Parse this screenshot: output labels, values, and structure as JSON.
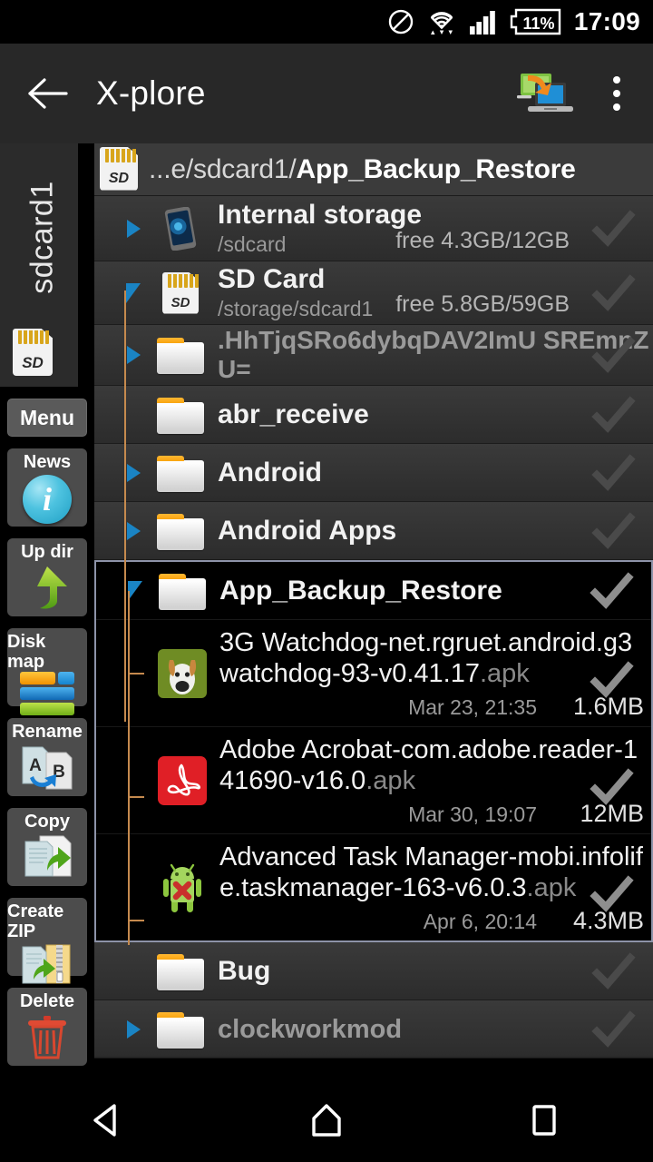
{
  "statusbar": {
    "icons": [
      "do-not-disturb-icon",
      "wifi-icon",
      "cellular-signal-icon",
      "battery-icon"
    ],
    "battery_percent": "11%",
    "clock": "17:09"
  },
  "appbar": {
    "back_label": "back-arrow",
    "title": "X-plore",
    "pc_transfer_icon": "wifi-pc-transfer-icon",
    "overflow_label": "more-options"
  },
  "sidebar": {
    "tab_label": "sdcard1",
    "tab_icon": "sd-card-icon",
    "menu_label": "Menu",
    "buttons": [
      {
        "label": "News",
        "icon": "info-circle-icon"
      },
      {
        "label": "Up dir",
        "icon": "up-arrow-icon"
      },
      {
        "label": "Disk map",
        "icon": "disk-map-icon"
      },
      {
        "label": "Rename",
        "icon": "rename-ab-icon"
      },
      {
        "label": "Copy",
        "icon": "copy-icon"
      },
      {
        "label": "Create ZIP",
        "icon": "zip-icon"
      },
      {
        "label": "Delete",
        "icon": "trash-icon"
      }
    ]
  },
  "breadcrumb": {
    "icon": "sd-card-icon",
    "prefix": "...e/sdcard1/",
    "current": "App_Backup_Restore"
  },
  "filelist": {
    "rows": [
      {
        "kind": "storage",
        "name": "Internal storage",
        "path": "/sdcard",
        "free": "free 4.3GB/12GB",
        "icon": "phone-icon",
        "expander": "collapsed",
        "checked": false,
        "highlight": false
      },
      {
        "kind": "storage",
        "name": "SD Card",
        "path": "/storage/sdcard1",
        "free": "free 5.8GB/59GB",
        "icon": "sd-card-icon",
        "expander": "expanded",
        "checked": false,
        "highlight": false
      },
      {
        "kind": "folder",
        "name": ".HhTjqSRo6dybqDAV2ImU SREmnZU=",
        "icon": "folder-icon",
        "expander": "collapsed",
        "dimmed": true,
        "checked": false,
        "highlight": false
      },
      {
        "kind": "folder",
        "name": "abr_receive",
        "icon": "folder-icon",
        "expander": "none",
        "checked": false,
        "highlight": false
      },
      {
        "kind": "folder",
        "name": "Android",
        "icon": "folder-icon",
        "expander": "collapsed",
        "checked": false,
        "highlight": false
      },
      {
        "kind": "folder",
        "name": "Android Apps",
        "icon": "folder-icon",
        "expander": "collapsed",
        "checked": false,
        "highlight": false
      }
    ],
    "highlighted_group": {
      "folder": {
        "kind": "folder",
        "name": "App_Backup_Restore",
        "icon": "folder-icon",
        "expander": "expanded",
        "checked": false
      },
      "files": [
        {
          "kind": "file",
          "name": "3G Watchdog-net.rgruet.android.g3watchdog-93-v0.41.17",
          "ext": ".apk",
          "icon": "3g-watchdog-app-icon",
          "date": "Mar 23, 21:35",
          "size": "1.6MB",
          "checked": false
        },
        {
          "kind": "file",
          "name": "Adobe Acrobat-com.adobe.reader-141690-v16.0",
          "ext": ".apk",
          "icon": "adobe-acrobat-app-icon",
          "date": "Mar 30, 19:07",
          "size": "12MB",
          "checked": false
        },
        {
          "kind": "file",
          "name": "Advanced Task Manager-mobi.infolife.taskmanager-163-v6.0.3",
          "ext": ".apk",
          "icon": "advanced-task-manager-app-icon",
          "date": "Apr 6, 20:14",
          "size": "4.3MB",
          "checked": false
        }
      ]
    },
    "rows_after": [
      {
        "kind": "folder",
        "name": "Bug",
        "icon": "folder-icon",
        "expander": "none",
        "checked": false,
        "highlight": false
      },
      {
        "kind": "folder",
        "name": "clockworkmod",
        "icon": "folder-icon",
        "expander": "collapsed",
        "dimmed": true,
        "checked": false,
        "highlight": false
      }
    ]
  },
  "navbar": {
    "back": "back-triangle-icon",
    "home": "home-icon",
    "recents": "recents-square-icon"
  },
  "colors": {
    "accent_blue": "#1a84c4",
    "folder_orange": "#f59100",
    "tree_line": "#c58a4e",
    "highlight_border": "#8d93a8",
    "appbar_bg": "#282828"
  }
}
